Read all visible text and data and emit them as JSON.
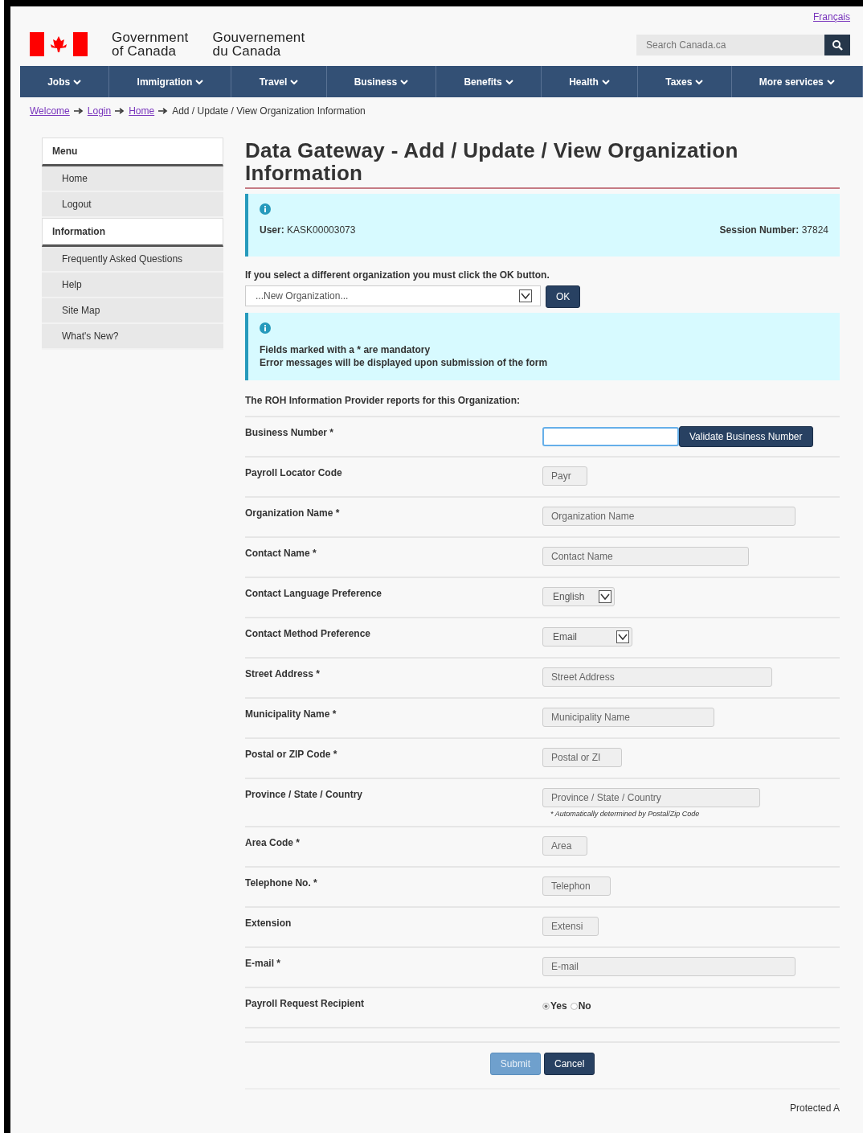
{
  "header": {
    "language_link": "Français",
    "name_en": [
      "Government",
      "of Canada"
    ],
    "name_fr": [
      "Gouvernement",
      "du Canada"
    ],
    "search": {
      "placeholder": "Search Canada.ca"
    }
  },
  "nav": [
    "Jobs",
    "Immigration",
    "Travel",
    "Business",
    "Benefits",
    "Health",
    "Taxes",
    "More services"
  ],
  "breadcrumb": {
    "links": [
      "Welcome",
      "Login",
      "Home"
    ],
    "current": "Add / Update / View Organization Information"
  },
  "sidebar": [
    {
      "heading": "Menu",
      "items": [
        "Home",
        "Logout"
      ]
    },
    {
      "heading": "Information",
      "items": [
        "Frequently Asked Questions",
        "Help",
        "Site Map",
        "What's New?"
      ]
    }
  ],
  "title": "Data Gateway - Add / Update / View Organization Information",
  "session_box": {
    "user_label": "User:",
    "user": "KASK00003073",
    "session_label": "Session Number:",
    "session": "37824"
  },
  "org_prompt": "If you select a different organization you must click the OK button.",
  "org_select": {
    "value": "...New Organization..."
  },
  "ok_button": "OK",
  "notice_box": [
    "Fields marked with a * are mandatory",
    "Error messages will be displayed upon submission of the form"
  ],
  "section_heading": "The ROH Information Provider reports for this Organization:",
  "fields": [
    {
      "label": "Business Number *",
      "kind": "input",
      "focused": true,
      "button": "Validate Business Number"
    },
    {
      "label": "Payroll Locator Code",
      "kind": "input",
      "placeholder": "Payr"
    },
    {
      "label": "Organization Name *",
      "kind": "input",
      "placeholder": "Organization Name"
    },
    {
      "label": "Contact Name *",
      "kind": "input",
      "placeholder": "Contact Name"
    },
    {
      "label": "Contact Language Preference",
      "kind": "select",
      "value": "English"
    },
    {
      "label": "Contact Method Preference",
      "kind": "select",
      "value": "Email"
    },
    {
      "label": "Street Address *",
      "kind": "input",
      "placeholder": "Street Address"
    },
    {
      "label": "Municipality Name *",
      "kind": "input",
      "placeholder": "Municipality Name"
    },
    {
      "label": "Postal or ZIP Code *",
      "kind": "input",
      "placeholder": "Postal or ZI"
    },
    {
      "label": "Province / State / Country",
      "kind": "input",
      "placeholder": "Province / State / Country",
      "hint": "* Automatically determined by Postal/Zip Code"
    },
    {
      "label": "Area Code *",
      "kind": "input",
      "placeholder": "Area"
    },
    {
      "label": "Telephone No. *",
      "kind": "input",
      "placeholder": "Telephon"
    },
    {
      "label": "Extension",
      "kind": "input",
      "placeholder": "Extensi"
    },
    {
      "label": "E-mail *",
      "kind": "input",
      "placeholder": "E-mail"
    },
    {
      "label": "Payroll Request Recipient",
      "kind": "radio",
      "options": [
        {
          "label": "Yes",
          "selected": true
        },
        {
          "label": "No",
          "selected": false
        }
      ]
    }
  ],
  "buttons": [
    {
      "label": "Submit",
      "kind": "primary"
    },
    {
      "label": "Cancel",
      "kind": "secondary"
    }
  ],
  "footer": "Protected A"
}
